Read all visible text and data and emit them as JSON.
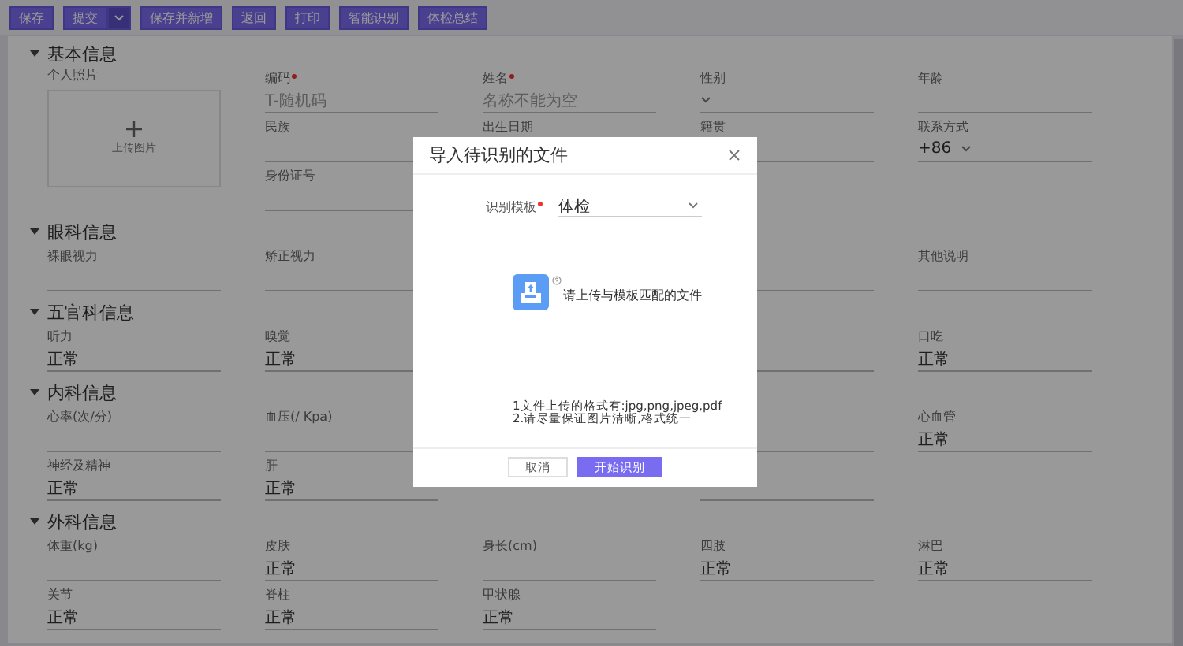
{
  "toolbar": {
    "buttons": [
      {
        "label": "保存",
        "kind": "plain"
      },
      {
        "label": "提交",
        "kind": "split"
      },
      {
        "label": "保存并新增",
        "kind": "plain"
      },
      {
        "label": "返回",
        "kind": "plain"
      },
      {
        "label": "打印",
        "kind": "plain"
      },
      {
        "label": "智能识别",
        "kind": "plain"
      },
      {
        "label": "体检总结",
        "kind": "plain"
      }
    ]
  },
  "sections": [
    {
      "title": "基本信息",
      "expanded": true,
      "photo": {
        "label": "个人照片",
        "upload_label": "上传图片"
      },
      "fields": [
        {
          "kind": "text",
          "label": "编码",
          "required": true,
          "placeholder": "T-随机码"
        },
        {
          "kind": "text",
          "label": "姓名",
          "required": true,
          "placeholder": "名称不能为空"
        },
        {
          "kind": "select",
          "label": "性别"
        },
        {
          "kind": "text",
          "label": "年龄"
        },
        {
          "kind": "text",
          "label": "民族"
        },
        {
          "kind": "label",
          "label": "出生日期"
        },
        {
          "kind": "select",
          "label": "籍贯"
        },
        {
          "kind": "phone",
          "label": "联系方式",
          "value": "+86"
        },
        {
          "kind": "text",
          "label": "身份证号"
        }
      ]
    },
    {
      "title": "眼科信息",
      "expanded": true,
      "fields": [
        {
          "kind": "text",
          "label": "裸眼视力"
        },
        {
          "kind": "text",
          "label": "矫正视力"
        },
        {
          "kind": "none"
        },
        {
          "kind": "text"
        },
        {
          "kind": "text",
          "label": "其他说明"
        }
      ]
    },
    {
      "title": "五官科信息",
      "expanded": true,
      "fields": [
        {
          "kind": "text",
          "label": "听力",
          "value": "正常"
        },
        {
          "kind": "text",
          "label": "嗅觉",
          "value": "正常"
        },
        {
          "kind": "none"
        },
        {
          "kind": "text"
        },
        {
          "kind": "text",
          "label": "口吃",
          "value": "正常"
        }
      ]
    },
    {
      "title": "内科信息",
      "expanded": true,
      "fields": [
        {
          "kind": "text",
          "label": "心率(次/分)"
        },
        {
          "kind": "text",
          "label": "血压(/ Kpa)"
        },
        {
          "kind": "none"
        },
        {
          "kind": "select"
        },
        {
          "kind": "text",
          "label": "心血管",
          "value": "正常"
        },
        {
          "kind": "text",
          "label": "神经及精神",
          "value": "正常"
        },
        {
          "kind": "text",
          "label": "肝",
          "value": "正常"
        },
        {
          "kind": "none"
        },
        {
          "kind": "text"
        }
      ]
    },
    {
      "title": "外科信息",
      "expanded": true,
      "fields": [
        {
          "kind": "text",
          "label": "体重(kg)"
        },
        {
          "kind": "text",
          "label": "皮肤",
          "value": "正常"
        },
        {
          "kind": "text",
          "label": "身长(cm)"
        },
        {
          "kind": "text",
          "label": "四肢",
          "value": "正常"
        },
        {
          "kind": "text",
          "label": "淋巴",
          "value": "正常"
        },
        {
          "kind": "text",
          "label": "关节",
          "value": "正常"
        },
        {
          "kind": "text",
          "label": "脊柱",
          "value": "正常"
        },
        {
          "kind": "text",
          "label": "甲状腺",
          "value": "正常"
        }
      ]
    }
  ],
  "dialog": {
    "title": "导入待识别的文件",
    "template": {
      "label": "识别模板",
      "required": true,
      "value": "体检"
    },
    "upload_hint": "请上传与模板匹配的文件",
    "notes": [
      "1文件上传的格式有:jpg,png,jpeg,pdf",
      "2.请尽量保证图片清晰,格式统一"
    ],
    "buttons": [
      {
        "label": "取消",
        "kind": "secondary"
      },
      {
        "label": "开始识别",
        "kind": "primary"
      }
    ]
  }
}
